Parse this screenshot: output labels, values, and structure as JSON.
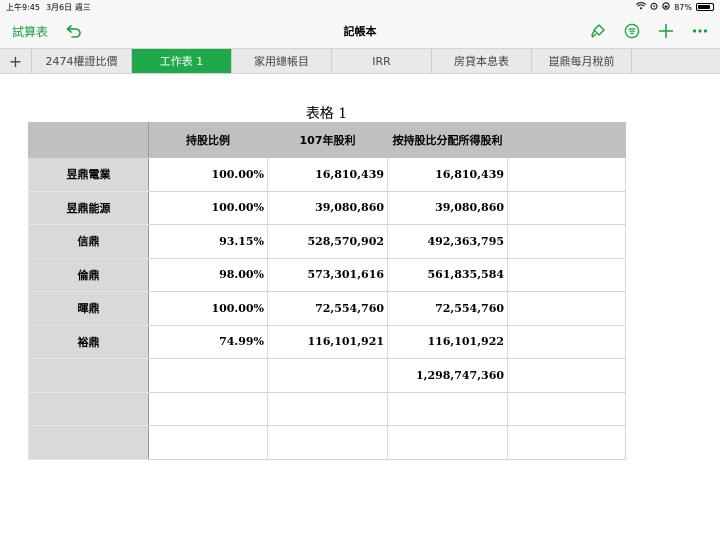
{
  "status_bar": {
    "time": "上午9:45",
    "date": "3月6日 週三",
    "battery": "87%",
    "battery_level": 0.87
  },
  "toolbar": {
    "spreadsheets_label": "試算表",
    "undo_icon": "undo-arrow-icon",
    "title": "記帳本",
    "format_icon": "paintbrush-icon",
    "organize_icon": "filter-list-icon",
    "add_icon": "plus-icon",
    "more_icon": "ellipsis-icon",
    "accent_color": "#1a9e3f"
  },
  "tabs": {
    "add_label": "+",
    "items": [
      {
        "label": "2474權證比價",
        "active": false
      },
      {
        "label": "工作表 1",
        "active": true
      },
      {
        "label": "家用總帳目",
        "active": false
      },
      {
        "label": "IRR",
        "active": false
      },
      {
        "label": "房貸本息表",
        "active": false
      },
      {
        "label": "崑鼎每月稅前",
        "active": false
      }
    ],
    "active_color": "#1fa94a"
  },
  "sheet": {
    "title": "表格 1",
    "headers": [
      "",
      "持股比例",
      "107年股利",
      "按持股比分配所得股利",
      ""
    ],
    "rows": [
      [
        "昱鼎電業",
        "100.00%",
        "16,810,439",
        "16,810,439",
        ""
      ],
      [
        "昱鼎能源",
        "100.00%",
        "39,080,860",
        "39,080,860",
        ""
      ],
      [
        "信鼎",
        "93.15%",
        "528,570,902",
        "492,363,795",
        ""
      ],
      [
        "倫鼎",
        "98.00%",
        "573,301,616",
        "561,835,584",
        ""
      ],
      [
        "暉鼎",
        "100.00%",
        "72,554,760",
        "72,554,760",
        ""
      ],
      [
        "裕鼎",
        "74.99%",
        "116,101,921",
        "116,101,922",
        ""
      ],
      [
        "",
        "",
        "",
        "1,298,747,360",
        ""
      ],
      [
        "",
        "",
        "",
        "",
        ""
      ],
      [
        "",
        "",
        "",
        "",
        ""
      ]
    ]
  }
}
